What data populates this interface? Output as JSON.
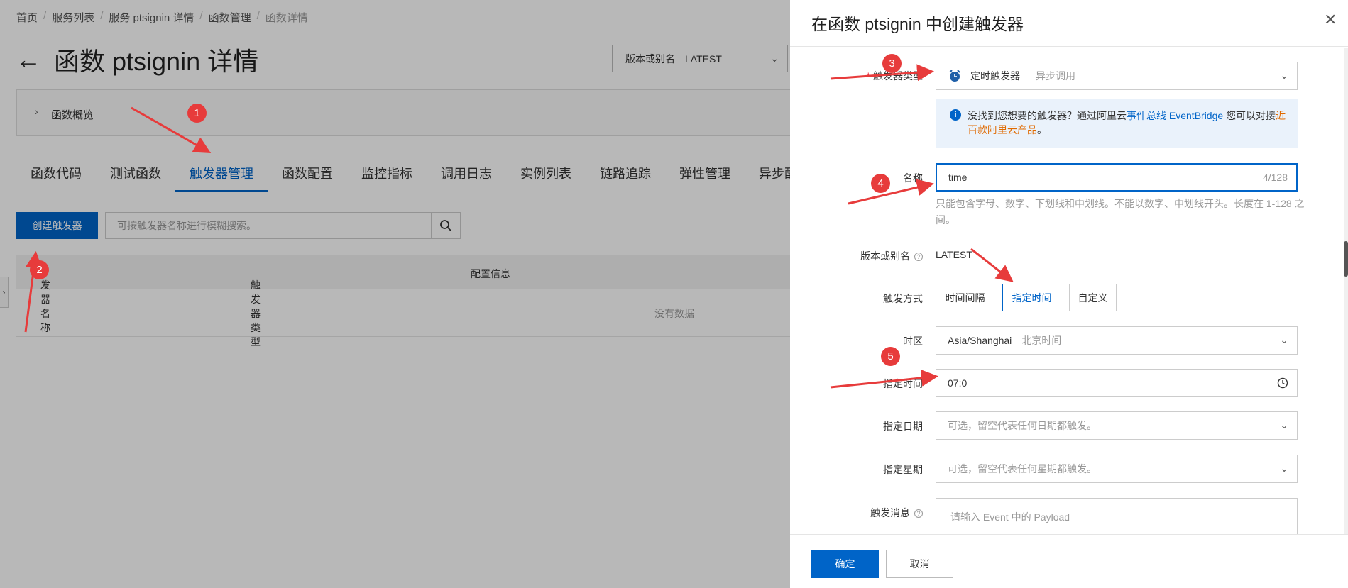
{
  "breadcrumb": [
    "首页",
    "服务列表",
    "服务 ptsignin 详情",
    "函数管理",
    "函数详情"
  ],
  "page_title": "函数 ptsignin 详情",
  "version_select": {
    "label": "版本或别名",
    "value": "LATEST"
  },
  "overview_label": "函数概览",
  "tabs": [
    "函数代码",
    "测试函数",
    "触发器管理",
    "函数配置",
    "监控指标",
    "调用日志",
    "实例列表",
    "链路追踪",
    "弹性管理",
    "异步配置"
  ],
  "active_tab_index": 2,
  "create_button": "创建触发器",
  "search_placeholder": "可按触发器名称进行模糊搜索。",
  "table": {
    "columns": [
      "发器名称",
      "触发器类型",
      "配置信息"
    ],
    "empty_text": "没有数据"
  },
  "drawer": {
    "title": "在函数 ptsignin 中创建触发器",
    "trigger_type": {
      "label": "触发器类型",
      "value": "定时触发器",
      "sub": "异步调用"
    },
    "info": {
      "text1": "没找到您想要的触发器？通过阿里云",
      "link1": "事件总线 EventBridge",
      "text2": "您可以对接",
      "link2": "近百款阿里云产品",
      "text3": "。"
    },
    "name": {
      "label": "名称",
      "value": "time",
      "counter": "4/128",
      "hint": "只能包含字母、数字、下划线和中划线。不能以数字、中划线开头。长度在 1-128 之间。"
    },
    "version": {
      "label": "版本或别名",
      "value": "LATEST"
    },
    "trigger_mode": {
      "label": "触发方式",
      "options": [
        "时间间隔",
        "指定时间",
        "自定义"
      ],
      "selected_index": 1
    },
    "timezone": {
      "label": "时区",
      "value": "Asia/Shanghai",
      "sub": "北京时间"
    },
    "specified_time": {
      "label": "指定时间",
      "value": "07:0"
    },
    "specified_date": {
      "label": "指定日期",
      "placeholder": "可选，留空代表任何日期都触发。"
    },
    "specified_week": {
      "label": "指定星期",
      "placeholder": "可选，留空代表任何星期都触发。"
    },
    "message": {
      "label": "触发消息",
      "placeholder": "请输入 Event 中的 Payload"
    },
    "ok": "确定",
    "cancel": "取消"
  },
  "markers": [
    "1",
    "2",
    "3",
    "4",
    "5"
  ],
  "colors": {
    "primary": "#0064c8",
    "marker": "#e73b3b",
    "link_orange": "#e06a00"
  }
}
